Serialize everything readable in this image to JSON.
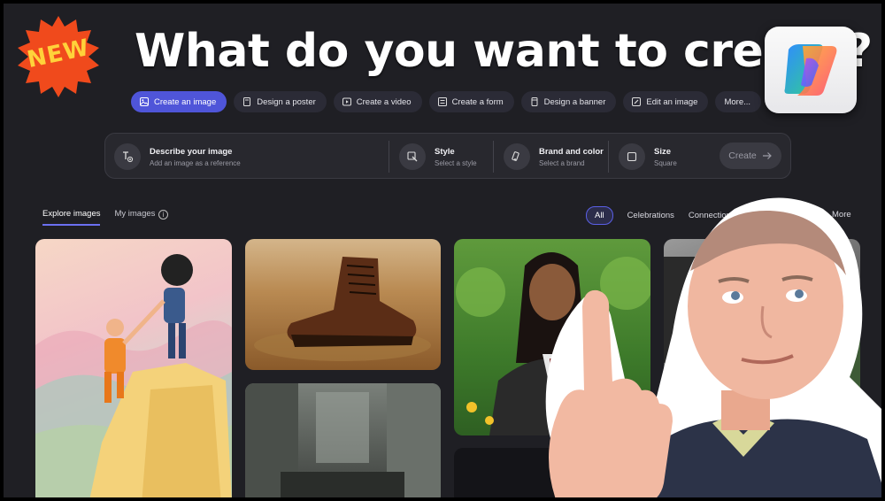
{
  "overlay": {
    "headline": "What do you want to create?",
    "badge_text": "NEW",
    "logo_icon": "copilot-logo-icon",
    "badge_color": "#f04a1c"
  },
  "quick_actions": [
    {
      "label": "Create an image",
      "icon": "image-icon",
      "active": true
    },
    {
      "label": "Design a poster",
      "icon": "poster-icon",
      "active": false
    },
    {
      "label": "Create a video",
      "icon": "video-icon",
      "active": false
    },
    {
      "label": "Create a form",
      "icon": "form-icon",
      "active": false
    },
    {
      "label": "Design a banner",
      "icon": "banner-icon",
      "active": false
    },
    {
      "label": "Edit an image",
      "icon": "edit-image-icon",
      "active": false
    },
    {
      "label": "More...",
      "icon": "",
      "active": false
    }
  ],
  "prompt": {
    "describe_title": "Describe your image",
    "describe_sub": "Add an image as a reference",
    "style_title": "Style",
    "style_sub": "Select a style",
    "brand_title": "Brand and color",
    "brand_sub": "Select a brand",
    "size_title": "Size",
    "size_sub": "Square",
    "create_label": "Create"
  },
  "tabs": [
    {
      "label": "Explore images",
      "active": true
    },
    {
      "label": "My images",
      "active": false
    }
  ],
  "filters": {
    "all": "All",
    "celebrations": "Celebrations",
    "connection": "Connection",
    "more": "More"
  },
  "colors": {
    "accent": "#4f55d9",
    "background": "#1f1f24"
  }
}
